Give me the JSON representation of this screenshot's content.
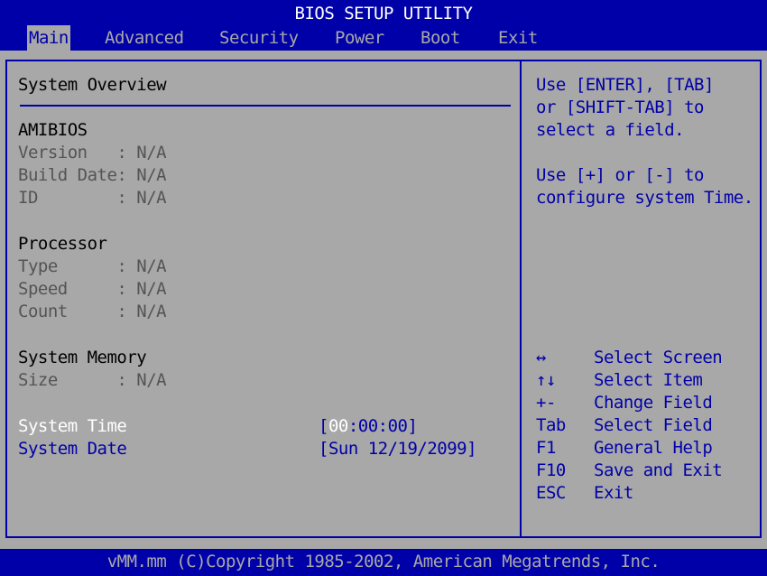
{
  "title": "BIOS SETUP UTILITY",
  "menu": [
    {
      "label": "Main",
      "active": true
    },
    {
      "label": "Advanced",
      "active": false
    },
    {
      "label": "Security",
      "active": false
    },
    {
      "label": "Power",
      "active": false
    },
    {
      "label": "Boot",
      "active": false
    },
    {
      "label": "Exit",
      "active": false
    }
  ],
  "overview": {
    "heading": "System Overview",
    "amibios": {
      "heading": "AMIBIOS",
      "version": "Version   : N/A",
      "build_date": "Build Date: N/A",
      "id": "ID        : N/A"
    },
    "processor": {
      "heading": "Processor",
      "type": "Type      : N/A",
      "speed": "Speed     : N/A",
      "count": "Count     : N/A"
    },
    "memory": {
      "heading": "System Memory",
      "size": "Size      : N/A"
    },
    "system_time": {
      "label": "System Time",
      "open": "[",
      "cursor": "00",
      "rest": ":00:00]"
    },
    "system_date": {
      "label": "System Date",
      "value": "[Sun 12/19/2099]"
    }
  },
  "help": {
    "line1": "Use [ENTER], [TAB]",
    "line2": "or [SHIFT-TAB] to",
    "line3": "select a field.",
    "line4": "Use [+] or [-] to",
    "line5": "configure system Time."
  },
  "keys": [
    {
      "key": "↔",
      "action": "Select Screen"
    },
    {
      "key": "↑↓",
      "action": "Select Item"
    },
    {
      "key": "+-",
      "action": "Change Field"
    },
    {
      "key": "Tab",
      "action": "Select Field"
    },
    {
      "key": "F1",
      "action": "General Help"
    },
    {
      "key": "F10",
      "action": "Save and Exit"
    },
    {
      "key": "ESC",
      "action": "Exit"
    }
  ],
  "footer": "vMM.mm (C)Copyright 1985-2002, American Megatrends, Inc.",
  "colors": {
    "background_blue": "#0000a8",
    "panel_gray": "#a8a8a8",
    "highlight_white": "#ffffff",
    "dim_text": "#545454"
  }
}
